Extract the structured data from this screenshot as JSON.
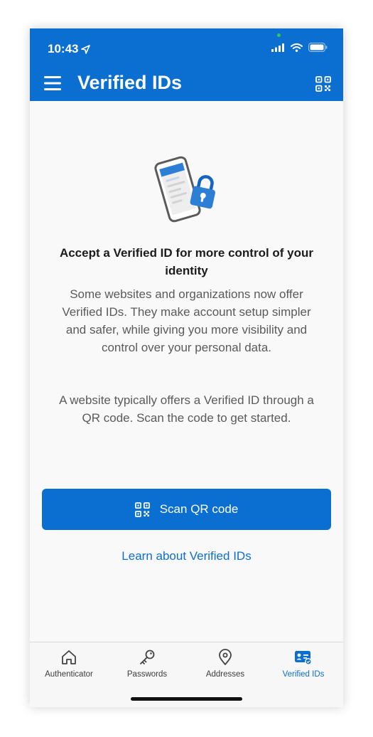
{
  "status_bar": {
    "time": "10:43"
  },
  "header": {
    "title": "Verified IDs",
    "accent_color": "#0a6fd1"
  },
  "content": {
    "heading": "Accept a Verified ID for more control of your identity",
    "paragraph1": "Some websites and organizations now offer Verified IDs. They make account setup simpler and safer, while giving you more visibility and control over your personal data.",
    "paragraph2": "A website typically offers a Verified ID through a QR code. Scan the code to get started.",
    "scan_button_label": "Scan QR code",
    "learn_link_label": "Learn about Verified IDs"
  },
  "tabbar": {
    "items": [
      {
        "label": "Authenticator",
        "icon": "house-icon",
        "active": false
      },
      {
        "label": "Passwords",
        "icon": "key-icon",
        "active": false
      },
      {
        "label": "Addresses",
        "icon": "location-pin-icon",
        "active": false
      },
      {
        "label": "Verified IDs",
        "icon": "id-card-icon",
        "active": true
      }
    ]
  }
}
